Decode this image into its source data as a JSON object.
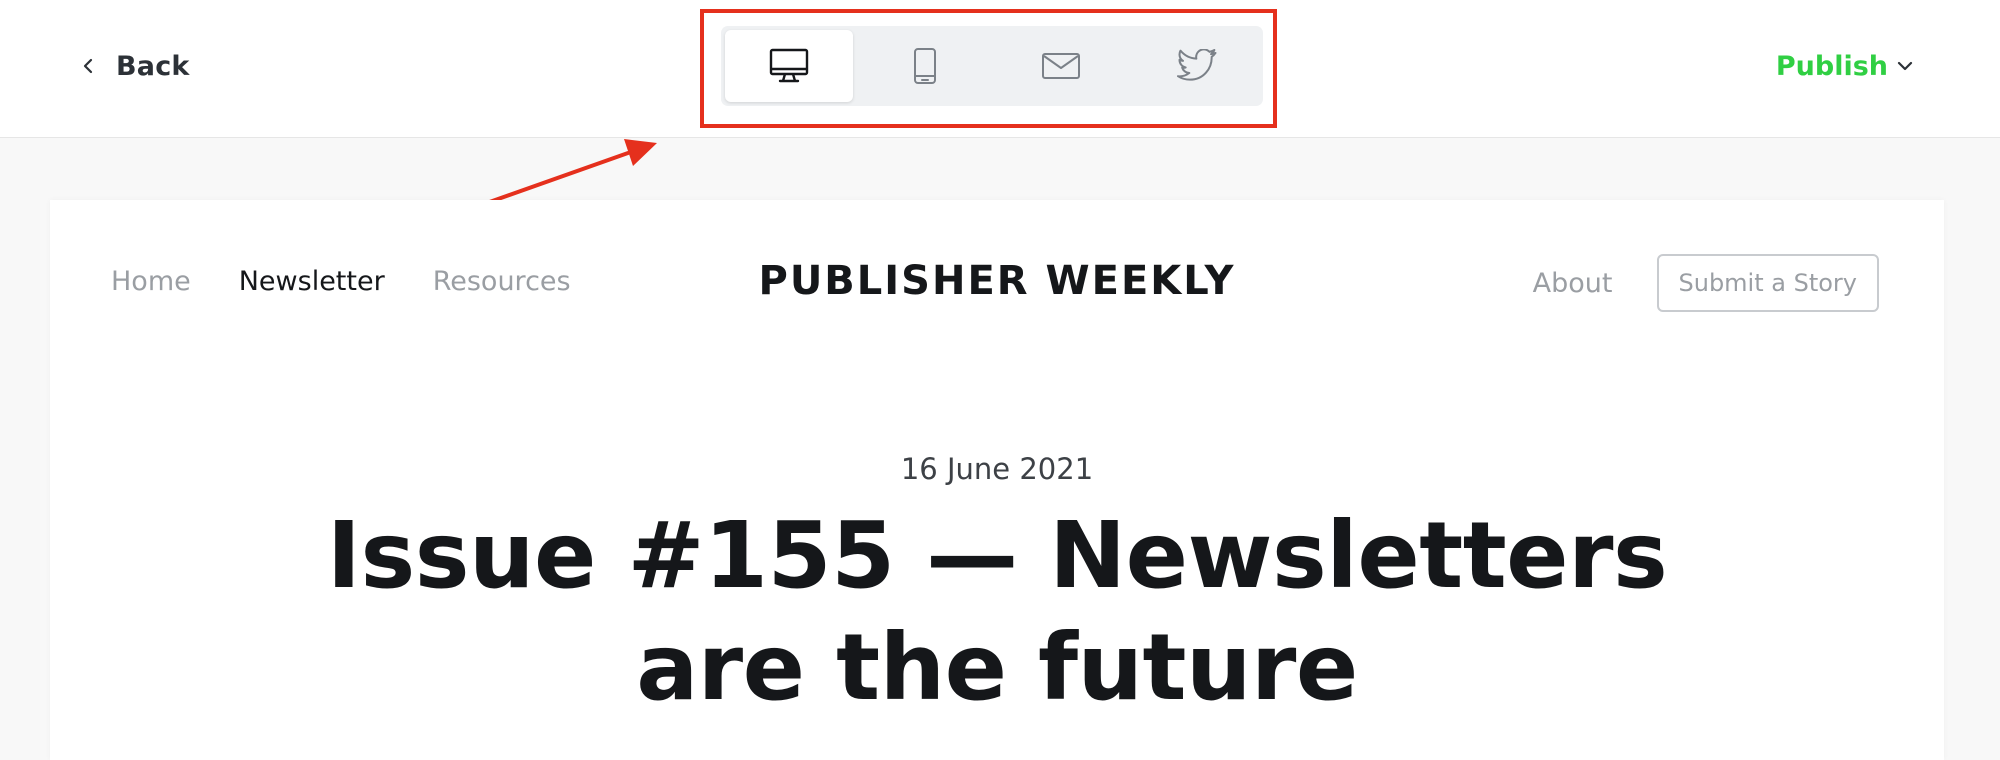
{
  "toolbar": {
    "back_label": "Back",
    "publish_label": "Publish",
    "devices": [
      {
        "name": "desktop",
        "icon": "desktop-icon",
        "active": true
      },
      {
        "name": "mobile",
        "icon": "mobile-icon",
        "active": false
      },
      {
        "name": "email",
        "icon": "email-icon",
        "active": false
      },
      {
        "name": "twitter",
        "icon": "twitter-icon",
        "active": false
      }
    ]
  },
  "preview": {
    "nav": [
      {
        "label": "Home",
        "current": false
      },
      {
        "label": "Newsletter",
        "current": true
      },
      {
        "label": "Resources",
        "current": false
      }
    ],
    "site_title": "PUBLISHER WEEKLY",
    "about_label": "About",
    "submit_label": "Submit a Story",
    "post_date": "16 June 2021",
    "post_title": "Issue #155 — Newsletters are the future"
  },
  "colors": {
    "accent_green": "#30cf43",
    "annotation_red": "#e5301d",
    "text_dark": "#15171a",
    "text_muted": "#9a9ea3"
  }
}
